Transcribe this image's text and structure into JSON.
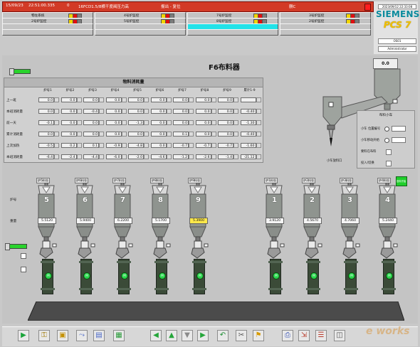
{
  "alarm": {
    "date": "15/09/23",
    "time": "22:51:00.335",
    "flag": "0",
    "message": "16FCD1.5/8横干度阀压力高",
    "state": "报出 - 复位",
    "tail": "删C"
  },
  "areas": [
    {
      "label": "物左系统",
      "hi": false
    },
    {
      "label": "4号炉监控",
      "hi": false
    },
    {
      "label": "7号炉监控",
      "hi": false
    },
    {
      "label": "3号炉监控",
      "hi": false
    },
    {
      "label": "2号炉监控",
      "hi": false
    },
    {
      "label": "5号炉监控",
      "hi": false
    },
    {
      "label": "8号炉监控",
      "hi": false
    },
    {
      "label": "2号炉监控",
      "hi": false
    },
    {
      "label": "",
      "hi": false
    },
    {
      "label": "",
      "hi": false
    },
    {
      "label": "",
      "hi": true
    },
    {
      "label": "",
      "hi": false
    },
    {
      "label": "",
      "hi": false
    },
    {
      "label": "",
      "hi": false
    },
    {
      "label": "",
      "hi": false
    },
    {
      "label": "",
      "hi": false
    }
  ],
  "brand": {
    "siemens": "SIEMENS",
    "pcs": "PCS 7",
    "server": "OS01",
    "user": "Administrator",
    "datetime": "2023/09/12 22:33:08"
  },
  "screen_title": "F6布料器",
  "feeder_top_value": "0.0",
  "consumption": {
    "title": "物料消耗量",
    "columns": [
      "炉号1",
      "炉号2",
      "炉号3",
      "炉号4",
      "炉号5",
      "炉号6",
      "炉号7",
      "炉号8",
      "炉号9",
      "累计1-9"
    ],
    "rows": [
      {
        "label": "上一班",
        "values": [
          "0.0",
          "0.0",
          "0.0",
          "0.0",
          "0.0",
          "0.0",
          "0.0",
          "0.0",
          "0.0",
          ""
        ]
      },
      {
        "label": "本班消耗量",
        "values": [
          "0.0",
          "0.0",
          "-0.4",
          "0.0",
          "0.0",
          "0.0",
          "0.0",
          "0.0",
          "0.0",
          "-0.40"
        ]
      },
      {
        "label": "前一天",
        "values": [
          "-0.1",
          "0.0",
          "0.0",
          "0.0",
          "-1.3",
          "0.0",
          "0.0",
          "0.0",
          "0.0",
          "-1.30"
        ]
      },
      {
        "label": "累计消耗量",
        "values": [
          "0.0",
          "0.0",
          "0.0",
          "0.0",
          "0.0",
          "0.0",
          "0.1",
          "0.0",
          "0.0",
          "-0.40"
        ]
      },
      {
        "label": "上次加热",
        "values": [
          "-0.5",
          "0.2",
          "0.1",
          "-0.9",
          "-4.8",
          "0.0",
          "-0.7",
          "-0.7",
          "-0.7",
          "-1.60"
        ]
      },
      {
        "label": "本班消耗量",
        "values": [
          "-6.4",
          "-2.4",
          "-4.4",
          "-6.0",
          "-2.0",
          "-4.6",
          "-1.2",
          "-2.6",
          "-1.4",
          "-21.12"
        ]
      }
    ]
  },
  "status_panel": {
    "title": "布料小车",
    "rows": [
      {
        "label": "小车 位置编号"
      },
      {
        "label": "小车移动开始"
      },
      {
        "label": "要料在布料"
      },
      {
        "label": "投入/切换"
      }
    ]
  },
  "exit_label": "小车放料口",
  "row_labels": {
    "furnace": "炉号",
    "weight": "重量"
  },
  "green_button": "投料开始",
  "furnaces": [
    {
      "num": "5",
      "scale": "炉5料仓",
      "value": "5.5120",
      "yellow": false
    },
    {
      "num": "6",
      "scale": "炉6料仓",
      "value": "5.9400",
      "yellow": false
    },
    {
      "num": "7",
      "scale": "炉7料仓",
      "value": "6.2200",
      "yellow": false
    },
    {
      "num": "8",
      "scale": "炉8料仓",
      "value": "5.1700",
      "yellow": false
    },
    {
      "num": "9",
      "scale": "炉9料仓",
      "value": "5.3900",
      "yellow": true
    },
    {
      "num": "1",
      "scale": "炉1料仓",
      "value": "3.9120",
      "yellow": false
    },
    {
      "num": "2",
      "scale": "炉2料仓",
      "value": "4.5670",
      "yellow": false
    },
    {
      "num": "3",
      "scale": "炉3料仓",
      "value": "4.7060",
      "yellow": false
    },
    {
      "num": "4",
      "scale": "炉4料仓",
      "value": "5.2440",
      "yellow": false
    }
  ],
  "mill_icon": "M",
  "toolbar": [
    {
      "name": "play-icon",
      "glyph": "▶",
      "color": "#1aa43a"
    },
    {
      "name": "key-icon",
      "glyph": "⚿",
      "color": "#a17800"
    },
    {
      "name": "page-icon",
      "glyph": "▣",
      "color": "#c49000"
    },
    {
      "name": "trend-icon",
      "glyph": "⤳",
      "color": "#4a67c7"
    },
    {
      "name": "report-icon",
      "glyph": "▤",
      "color": "#4a67c7"
    },
    {
      "name": "overview-icon",
      "glyph": "▦",
      "color": "#2a9a3a"
    },
    {
      "name": "nav-left-icon",
      "glyph": "◀",
      "color": "#25a63a"
    },
    {
      "name": "nav-up-icon",
      "glyph": "▲",
      "color": "#25a63a"
    },
    {
      "name": "nav-down-icon",
      "glyph": "▼",
      "color": "#8a8a8a"
    },
    {
      "name": "nav-right-icon",
      "glyph": "▶",
      "color": "#25a63a"
    },
    {
      "name": "back-icon",
      "glyph": "↶",
      "color": "#1f8f35"
    },
    {
      "name": "tools-icon",
      "glyph": "✂",
      "color": "#555555"
    },
    {
      "name": "lock-icon",
      "glyph": "⚑",
      "color": "#d69a00"
    },
    {
      "name": "print-icon",
      "glyph": "⎙",
      "color": "#3a56b8"
    },
    {
      "name": "export-icon",
      "glyph": "⇲",
      "color": "#b93a2a"
    },
    {
      "name": "alarm-list-icon",
      "glyph": "☰",
      "color": "#b93a2a"
    },
    {
      "name": "screen-icon",
      "glyph": "◫",
      "color": "#555555"
    }
  ]
}
